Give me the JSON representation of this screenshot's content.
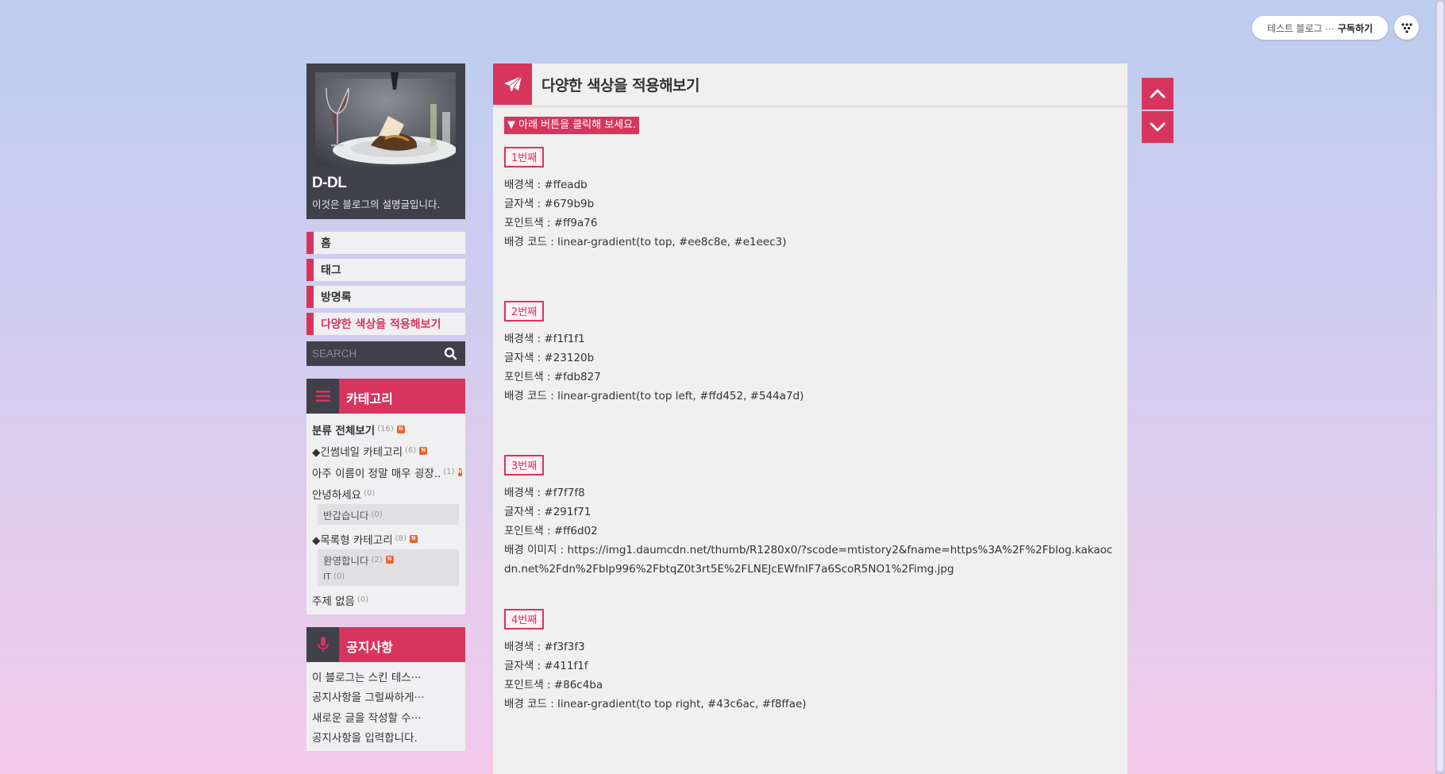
{
  "topbar": {
    "subscribe_blog": "테스트 블로그 ···",
    "subscribe_action": "구독하기",
    "menu_icon": "dots-icon"
  },
  "profile": {
    "blog_name": "D-DL",
    "description": "이것은 블로그의 설명글입니다."
  },
  "nav": [
    "홈",
    "태그",
    "방명록",
    "다양한 색상을 적용해보기"
  ],
  "search": {
    "placeholder": "SEARCH"
  },
  "category": {
    "title": "카테고리",
    "all": {
      "label": "분류 전체보기",
      "count": "(16)"
    },
    "items": [
      {
        "label": "◆긴썸네일 카테고리",
        "count": "(6)"
      },
      {
        "label": "아주 이름이 정말 매우 굉장..",
        "count": "(1)"
      },
      {
        "label": "안녕하세요",
        "count": "(0)"
      }
    ],
    "sub1": {
      "label": "반갑습니다",
      "count": "(0)"
    },
    "list_cat": {
      "label": "◆목록형 카테고리",
      "count": "(8)"
    },
    "sub2": [
      {
        "label": "환영합니다",
        "count": "(2)"
      },
      {
        "label": "IT",
        "count": "(0)"
      }
    ],
    "none": {
      "label": "주제 없음",
      "count": "(0)"
    },
    "new_badge": "N"
  },
  "notice": {
    "title": "공지사항",
    "items": [
      "이 블로그는 스킨 테스···",
      "공지사항을 그럴싸하게···",
      "새로운 글을 작성할 수···",
      "공지사항을 입력합니다."
    ]
  },
  "main": {
    "title": "다양한 색상을 적용해보기",
    "hint": "▼ 아래 버튼을 클릭해 보세요.",
    "sections": [
      {
        "tag": "1번째",
        "lines": [
          "배경색 : #ffeadb",
          "글자색 : #679b9b",
          "포인트색 : #ff9a76",
          "배경 코드 : linear-gradient(to top, #ee8c8e, #e1eec3)"
        ]
      },
      {
        "tag": "2번째",
        "lines": [
          "배경색 : #f1f1f1",
          "글자색 : #23120b",
          "포인트색 : #fdb827",
          "배경 코드 : linear-gradient(to top left, #ffd452, #544a7d)"
        ]
      },
      {
        "tag": "3번째",
        "lines": [
          "배경색 : #f7f7f8",
          "글자색 : #291f71",
          "포인트색 : #ff6d02",
          "배경 이미지 : https://img1.daumcdn.net/thumb/R1280x0/?scode=mtistory2&fname=https%3A%2F%2Fblog.kakaocdn.net%2Fdn%2Fblp996%2FbtqZ0t3rt5E%2FLNEJcEWfnIF7a6ScoR5NO1%2Fimg.jpg"
        ]
      },
      {
        "tag": "4번째",
        "lines": [
          "배경색 : #f3f3f3",
          "글자색 : #411f1f",
          "포인트색 : #86c4ba",
          "배경 코드 : linear-gradient(to top right, #43c6ac, #f8ffae)"
        ]
      }
    ]
  },
  "colors": {
    "accent": "#d7355e",
    "dark": "#3f4049",
    "panel": "#f0f0f0"
  }
}
